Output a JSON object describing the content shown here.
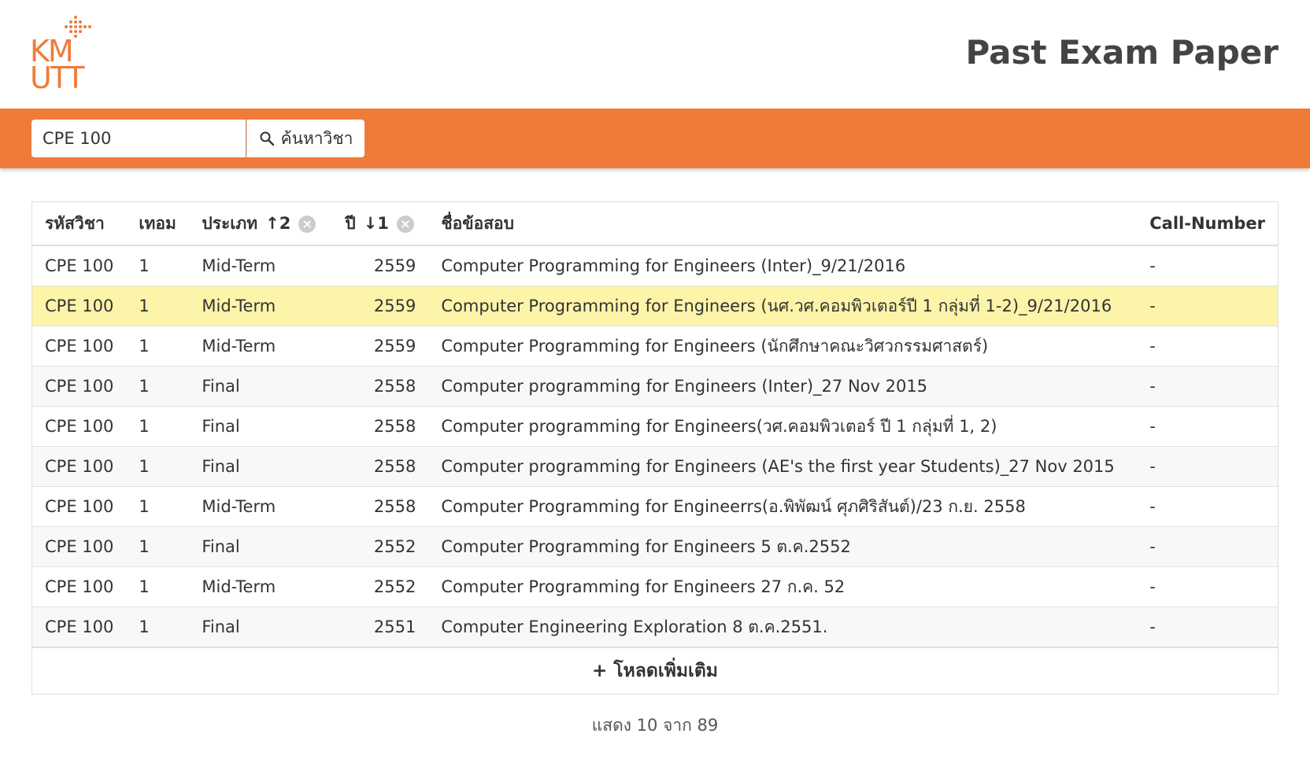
{
  "header": {
    "logo_text": [
      "KM",
      "UTT"
    ],
    "title": "Past Exam Paper"
  },
  "search": {
    "value": "CPE 100",
    "button_label": "ค้นหาวิชา",
    "icon": "search-icon"
  },
  "table": {
    "headers": {
      "code": "รหัสวิชา",
      "term": "เทอม",
      "type": "ประเภท",
      "type_sort": "↑2",
      "year": "ปี",
      "year_sort": "↓1",
      "name": "ชื่อข้อสอบ",
      "call": "Call-Number"
    },
    "rows": [
      {
        "code": "CPE 100",
        "term": "1",
        "type": "Mid-Term",
        "year": "2559",
        "name": "Computer Programming for Engineers (Inter)_9/21/2016",
        "call": "-"
      },
      {
        "code": "CPE 100",
        "term": "1",
        "type": "Mid-Term",
        "year": "2559",
        "name": "Computer Programming for Engineers (นศ.วศ.คอมพิวเตอร์ปี 1 กลุ่มที่ 1-2)_9/21/2016",
        "call": "-"
      },
      {
        "code": "CPE 100",
        "term": "1",
        "type": "Mid-Term",
        "year": "2559",
        "name": "Computer Programming for Engineers (นักศึกษาคณะวิศวกรรมศาสตร์)",
        "call": "-"
      },
      {
        "code": "CPE 100",
        "term": "1",
        "type": "Final",
        "year": "2558",
        "name": "Computer programming for Engineers (Inter)_27 Nov 2015",
        "call": "-"
      },
      {
        "code": "CPE 100",
        "term": "1",
        "type": "Final",
        "year": "2558",
        "name": "Computer programming for Engineers(วศ.คอมพิวเตอร์ ปี 1 กลุ่มที่ 1, 2)",
        "call": "-"
      },
      {
        "code": "CPE 100",
        "term": "1",
        "type": "Final",
        "year": "2558",
        "name": "Computer programming for Engineers (AE's the first year Students)_27 Nov 2015",
        "call": "-"
      },
      {
        "code": "CPE 100",
        "term": "1",
        "type": "Mid-Term",
        "year": "2558",
        "name": "Computer Programming for Engineerrs(อ.พิพัฒน์ ศุภศิริสันต์)/23 ก.ย. 2558",
        "call": "-"
      },
      {
        "code": "CPE 100",
        "term": "1",
        "type": "Final",
        "year": "2552",
        "name": "Computer Programming for Engineers 5 ต.ค.2552",
        "call": "-"
      },
      {
        "code": "CPE 100",
        "term": "1",
        "type": "Mid-Term",
        "year": "2552",
        "name": "Computer Programming for Engineers 27 ก.ค. 52",
        "call": "-"
      },
      {
        "code": "CPE 100",
        "term": "1",
        "type": "Final",
        "year": "2551",
        "name": "Computer Engineering Exploration 8 ต.ค.2551.",
        "call": "-"
      }
    ],
    "highlighted_row": 1,
    "load_more_label": "โหลดเพิ่มเติม"
  },
  "footer": {
    "count_text": "แสดง 10 จาก 89"
  },
  "colors": {
    "accent": "#f07b39",
    "highlight": "#fcf4a8"
  }
}
